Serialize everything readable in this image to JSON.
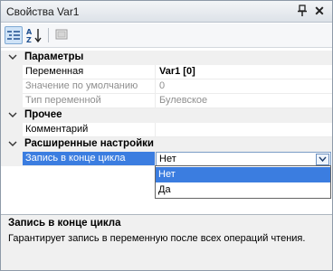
{
  "window": {
    "title": "Свойства Var1"
  },
  "toolbar": {
    "buttons": [
      {
        "icon": "categorized-view-icon",
        "active": true
      },
      {
        "icon": "sort-alphabetical-icon",
        "active": false
      },
      {
        "icon": "property-pages-icon",
        "active": false
      }
    ]
  },
  "categories": {
    "params": {
      "label": "Параметры",
      "rows": [
        {
          "name": "Переменная",
          "value": "Var1 [0]"
        },
        {
          "name": "Значение по умолчанию",
          "value": "0"
        },
        {
          "name": "Тип переменной",
          "value": "Булевское"
        }
      ]
    },
    "other": {
      "label": "Прочее",
      "rows": [
        {
          "name": "Комментарий",
          "value": ""
        }
      ]
    },
    "advanced": {
      "label": "Расширенные настройки",
      "rows": [
        {
          "name": "Запись в конце цикла",
          "value": "Нет"
        }
      ]
    }
  },
  "dropdown": {
    "options": [
      "Нет",
      "Да"
    ],
    "selected": "Нет"
  },
  "description": {
    "title": "Запись в конце цикла",
    "text": "Гарантирует запись в переменную после всех операций чтения."
  },
  "colors": {
    "selection": "#3b7de0",
    "category_bg": "#f0f0f0",
    "disabled_text": "#8f8f8f"
  }
}
